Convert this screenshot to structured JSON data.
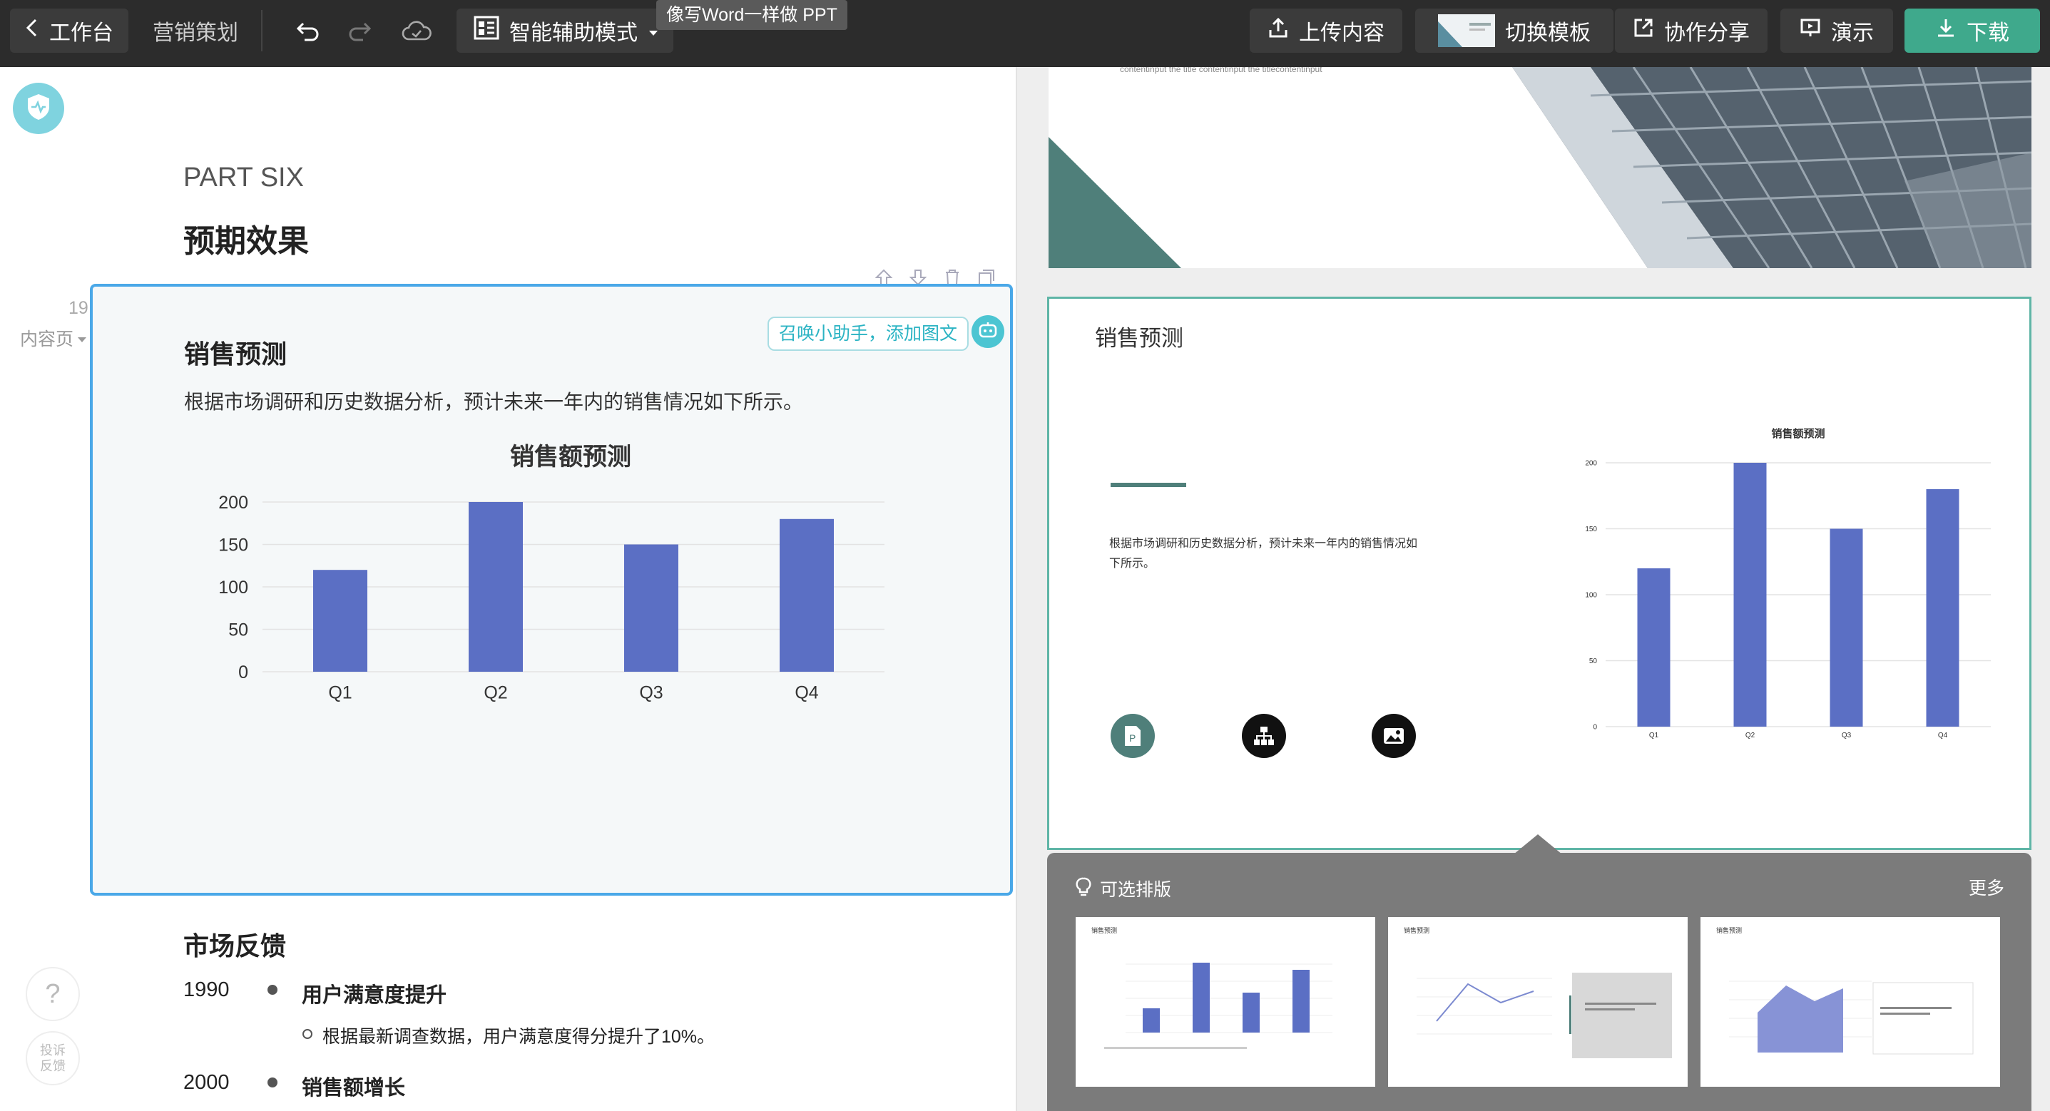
{
  "toolbar": {
    "back_label": "工作台",
    "doc_title": "营销策划",
    "mode_label": "智能辅助模式",
    "tooltip": "像写Word一样做 PPT",
    "upload_label": "上传内容",
    "switch_template_label": "切换模板",
    "share_label": "协作分享",
    "present_label": "演示",
    "download_label": "下载"
  },
  "editor": {
    "part_label": "PART SIX",
    "section_title": "预期效果",
    "page_number": "19",
    "page_type": "内容页",
    "card_title": "销售预测",
    "card_desc": "根据市场调研和历史数据分析，预计未来一年内的销售情况如下所示。",
    "assistant_hint": "召唤小助手，添加图文",
    "feedback_title": "市场反馈",
    "timeline": [
      {
        "year": "1990",
        "title": "用户满意度提升",
        "sub": "根据最新调查数据，用户满意度得分提升了10%。"
      },
      {
        "year": "2000",
        "title": "销售额增长",
        "sub": ""
      }
    ],
    "help_label": "?",
    "complaint_line1": "投诉",
    "complaint_line2": "反馈"
  },
  "chart_data": {
    "type": "bar",
    "title": "销售额预测",
    "categories": [
      "Q1",
      "Q2",
      "Q3",
      "Q4"
    ],
    "values": [
      120,
      200,
      150,
      180
    ],
    "ylim": [
      0,
      200
    ],
    "yticks": [
      0,
      50,
      100,
      150,
      200
    ],
    "color": "#5b6fc4"
  },
  "preview": {
    "top_slide_caption": "contentinput the title contentinput the titlecontentinput",
    "slide_title": "销售预测",
    "slide_desc": "根据市场调研和历史数据分析，预计未来一年内的销售情况如下所示。",
    "accent_color": "#4f7f7a"
  },
  "layouts": {
    "title": "可选排版",
    "more_label": "更多",
    "items": [
      {
        "title": "销售预测",
        "kind": "bar"
      },
      {
        "title": "销售预测",
        "kind": "line"
      },
      {
        "title": "销售预测",
        "kind": "area"
      }
    ]
  },
  "colors": {
    "topbar": "#2c2c2c",
    "selected_border": "#4aa8e8",
    "accent_green": "#3fa98c",
    "bar_blue": "#5b6fc4"
  }
}
